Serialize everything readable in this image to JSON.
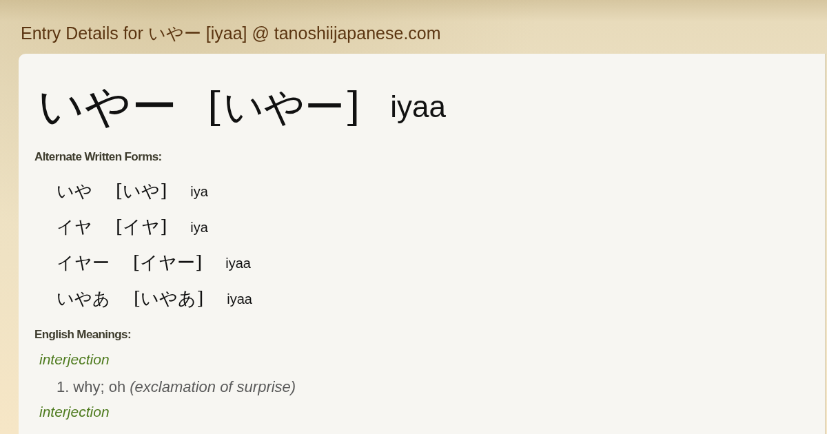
{
  "page_title": "Entry Details for いやー [iyaa] @ tanoshiijapanese.com",
  "entry": {
    "word": "いやー",
    "reading": "[いやー]",
    "romaji": "iyaa"
  },
  "alternate_forms": {
    "heading": "Alternate Written Forms:",
    "items": [
      {
        "word": "いや",
        "reading": "[いや]",
        "romaji": "iya"
      },
      {
        "word": "イヤ",
        "reading": "[イヤ]",
        "romaji": "iya"
      },
      {
        "word": "イヤー",
        "reading": "[イヤー]",
        "romaji": "iyaa"
      },
      {
        "word": "いやあ",
        "reading": "[いやあ]",
        "romaji": "iyaa"
      }
    ]
  },
  "meanings": {
    "heading": "English Meanings:",
    "groups": [
      {
        "part_of_speech": "interjection",
        "senses": [
          {
            "number": "1.",
            "text": "why; oh *(exclamation of surprise)*"
          }
        ]
      },
      {
        "part_of_speech": "interjection"
      }
    ]
  }
}
